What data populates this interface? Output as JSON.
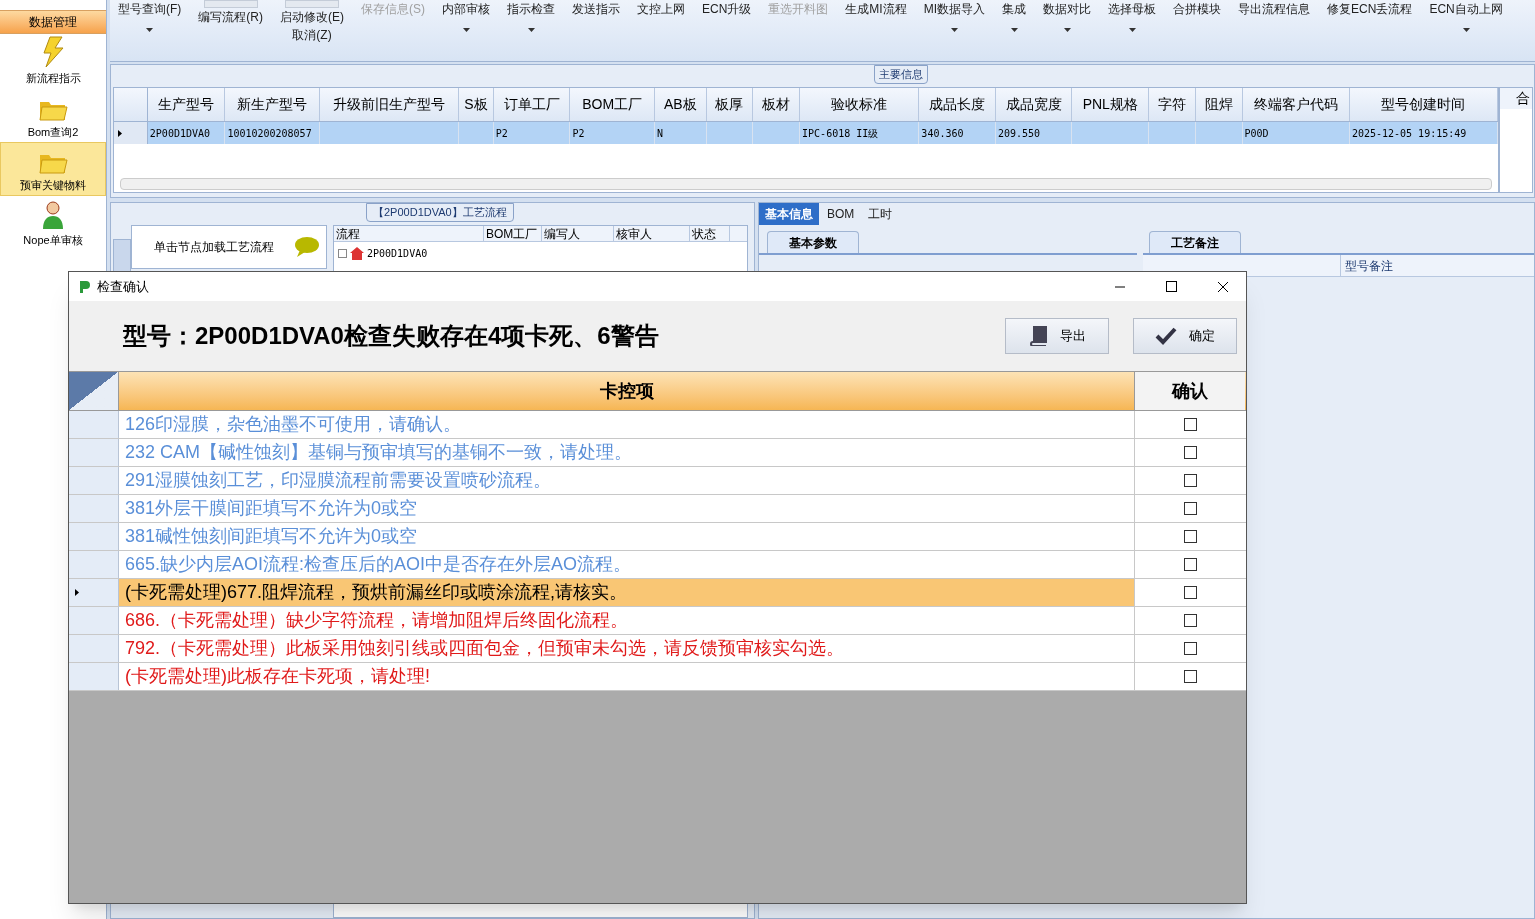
{
  "sidebar": {
    "header": "数据管理",
    "items": [
      {
        "label": "新流程指示",
        "kind": "bolt",
        "selected": false
      },
      {
        "label": "Bom查询2",
        "kind": "folder",
        "selected": false
      },
      {
        "label": "预审关键物料",
        "kind": "folder",
        "selected": true
      },
      {
        "label": "Nope单审核",
        "kind": "person",
        "selected": false
      }
    ]
  },
  "toolbar": [
    {
      "label": "型号查询(F)",
      "dropdown": true,
      "disabled": false
    },
    {
      "label": "编写流程(R)",
      "kind": "tall",
      "dropdown": false,
      "disabled": false
    },
    {
      "label": "启动修改(E)",
      "kind": "tall",
      "second_line": "取消(Z)",
      "dropdown": false,
      "disabled": false
    },
    {
      "label": "保存信息(S)",
      "dropdown": false,
      "disabled": true
    },
    {
      "label": "内部审核",
      "dropdown": true,
      "disabled": false
    },
    {
      "label": "指示检查",
      "dropdown": true,
      "disabled": false
    },
    {
      "label": "发送指示",
      "dropdown": false,
      "disabled": false
    },
    {
      "label": "文控上网",
      "dropdown": false,
      "disabled": false
    },
    {
      "label": "ECN升级",
      "dropdown": false,
      "disabled": false
    },
    {
      "label": "重选开料图",
      "dropdown": false,
      "disabled": true
    },
    {
      "label": "生成MI流程",
      "dropdown": false,
      "disabled": false
    },
    {
      "label": "MI数据导入",
      "dropdown": true,
      "disabled": false
    },
    {
      "label": "集成",
      "dropdown": true,
      "disabled": false
    },
    {
      "label": "数据对比",
      "dropdown": true,
      "disabled": false
    },
    {
      "label": "选择母板",
      "dropdown": true,
      "disabled": false
    },
    {
      "label": "合拼模块",
      "dropdown": false,
      "disabled": false
    },
    {
      "label": "导出流程信息",
      "dropdown": false,
      "disabled": false
    },
    {
      "label": "修复ECN丢流程",
      "dropdown": false,
      "disabled": false
    },
    {
      "label": "ECN自动上网",
      "dropdown": true,
      "disabled": false
    }
  ],
  "main_info": {
    "title": "主要信息",
    "side_label": "合",
    "columns": [
      "生产型号",
      "新生产型号",
      "升级前旧生产型号",
      "S板",
      "订单工厂",
      "BOM工厂",
      "AB板",
      "板厚",
      "板材",
      "验收标准",
      "成品长度",
      "成品宽度",
      "PNL规格",
      "字符",
      "阻焊",
      "终端客户代码",
      "型号创建时间"
    ],
    "rows": [
      {
        "selected": true,
        "cells": [
          "2P00D1DVA0",
          "10010200208057",
          "",
          "",
          "P2",
          "P2",
          "N",
          "",
          "",
          "IPC-6018 II级",
          "340.360",
          "209.550",
          "",
          "",
          "",
          "P00D",
          "2025-12-05 19:15:49"
        ]
      }
    ]
  },
  "process_panel": {
    "hint": "单击节点加载工艺流程",
    "group_title": "【2P00D1DVA0】工艺流程",
    "columns": [
      "流程",
      "BOM工厂",
      "编写人",
      "核审人",
      "状态"
    ],
    "tree_root": "2P00D1DVA0"
  },
  "detail_panel": {
    "tabs": [
      {
        "label": "基本信息",
        "selected": true
      },
      {
        "label": "BOM",
        "selected": false
      },
      {
        "label": "工时",
        "selected": false
      }
    ],
    "sub_tab": "基本参数",
    "notes_tab": "工艺备注",
    "notes_column": "型号备注"
  },
  "dialog": {
    "title": "检查确认",
    "heading": "型号：2P00D1DVA0检查失败存在4项卡死、6警告",
    "buttons": [
      {
        "label": "导出",
        "kind": "book"
      },
      {
        "label": "确定",
        "kind": "check"
      }
    ],
    "columns": [
      "卡控项",
      "确认"
    ],
    "rows": [
      {
        "text": "126印湿膜，杂色油墨不可使用，请确认。",
        "kind": "warning",
        "selected": false,
        "checked": false
      },
      {
        "text": "232 CAM【碱性蚀刻】基铜与预审填写的基铜不一致，请处理。",
        "kind": "warning",
        "selected": false,
        "checked": false
      },
      {
        "text": "291湿膜蚀刻工艺，印湿膜流程前需要设置喷砂流程。",
        "kind": "warning",
        "selected": false,
        "checked": false
      },
      {
        "text": "381外层干膜间距填写不允许为0或空",
        "kind": "warning",
        "selected": false,
        "checked": false
      },
      {
        "text": "381碱性蚀刻间距填写不允许为0或空",
        "kind": "warning",
        "selected": false,
        "checked": false
      },
      {
        "text": "665.缺少内层AOI流程:检查压后的AOI中是否存在外层AO流程。",
        "kind": "warning",
        "selected": false,
        "checked": false
      },
      {
        "text": "(卡死需处理)677.阻焊流程，预烘前漏丝印或喷涂流程,请核实。",
        "kind": "blocking",
        "selected": true,
        "checked": false
      },
      {
        "text": "686.（卡死需处理）缺少字符流程，请增加阻焊后终固化流程。",
        "kind": "blocking",
        "selected": false,
        "checked": false
      },
      {
        "text": "792.（卡死需处理）此板采用蚀刻引线或四面包金，但预审未勾选，请反馈预审核实勾选。",
        "kind": "blocking",
        "selected": false,
        "checked": false
      },
      {
        "text": "(卡死需处理)此板存在卡死项，请处理!",
        "kind": "blocking",
        "selected": false,
        "checked": false
      }
    ]
  }
}
